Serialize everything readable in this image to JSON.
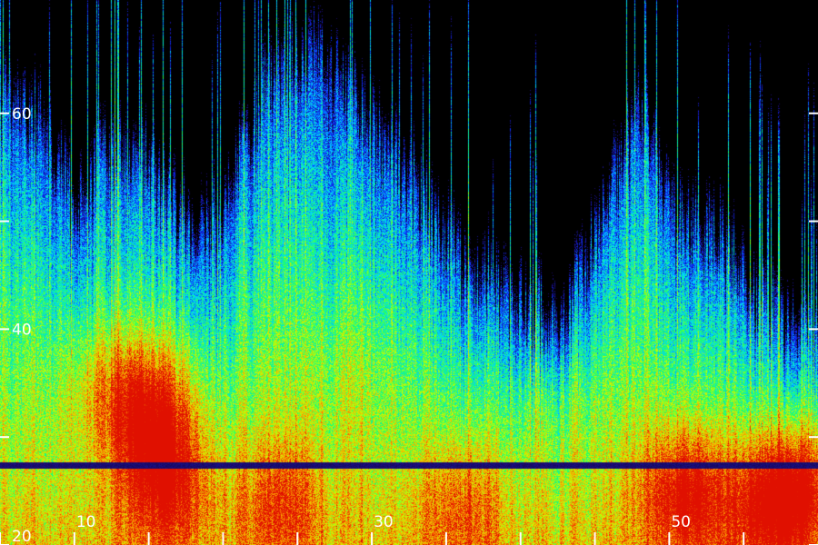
{
  "chart_data": {
    "type": "heatmap",
    "title": "",
    "xlabel": "",
    "ylabel": "",
    "xlim": [
      5,
      60
    ],
    "ylim": [
      20,
      70.5
    ],
    "x_tick_labels": [
      {
        "value": 10,
        "label": "10"
      },
      {
        "value": 30,
        "label": "30"
      },
      {
        "value": 50,
        "label": "50"
      }
    ],
    "x_minor_ticks": [
      5,
      15,
      20,
      25,
      35,
      40,
      45,
      55
    ],
    "y_tick_labels": [
      {
        "value": 20,
        "label": "20"
      },
      {
        "value": 40,
        "label": "40"
      },
      {
        "value": 60,
        "label": "60"
      }
    ],
    "y_minor_ticks": [
      30,
      50
    ],
    "horizontal_band_y": 27.4,
    "colormap": [
      "#000000",
      "#1a0a6e",
      "#0a2cff",
      "#00d8ff",
      "#1aff6a",
      "#c8ff00",
      "#ff9a00",
      "#e01000"
    ],
    "grid": false,
    "legend": "none",
    "intensity_envelope": [
      {
        "x": 5,
        "top": 60
      },
      {
        "x": 8,
        "top": 58
      },
      {
        "x": 10,
        "top": 50
      },
      {
        "x": 12,
        "top": 56
      },
      {
        "x": 15,
        "top": 54
      },
      {
        "x": 18,
        "top": 48
      },
      {
        "x": 20,
        "top": 50
      },
      {
        "x": 23,
        "top": 62
      },
      {
        "x": 26,
        "top": 66
      },
      {
        "x": 30,
        "top": 58
      },
      {
        "x": 33,
        "top": 52
      },
      {
        "x": 36,
        "top": 45
      },
      {
        "x": 40,
        "top": 42
      },
      {
        "x": 43,
        "top": 40
      },
      {
        "x": 46,
        "top": 52
      },
      {
        "x": 48,
        "top": 60
      },
      {
        "x": 50,
        "top": 50
      },
      {
        "x": 53,
        "top": 48
      },
      {
        "x": 56,
        "top": 42
      },
      {
        "x": 60,
        "top": 38
      }
    ],
    "hotspots": [
      {
        "x": 15,
        "y": 33,
        "level": 0.95
      },
      {
        "x": 16,
        "y": 26,
        "level": 0.9
      },
      {
        "x": 12,
        "y": 35,
        "level": 0.7
      },
      {
        "x": 24,
        "y": 24,
        "level": 0.8
      },
      {
        "x": 36,
        "y": 24,
        "level": 0.75
      },
      {
        "x": 51,
        "y": 25,
        "level": 0.95
      },
      {
        "x": 57,
        "y": 24,
        "level": 0.9
      },
      {
        "x": 59,
        "y": 26,
        "level": 0.85
      },
      {
        "x": 42,
        "y": 32,
        "level": 0.65
      },
      {
        "x": 28,
        "y": 36,
        "level": 0.6
      }
    ]
  }
}
